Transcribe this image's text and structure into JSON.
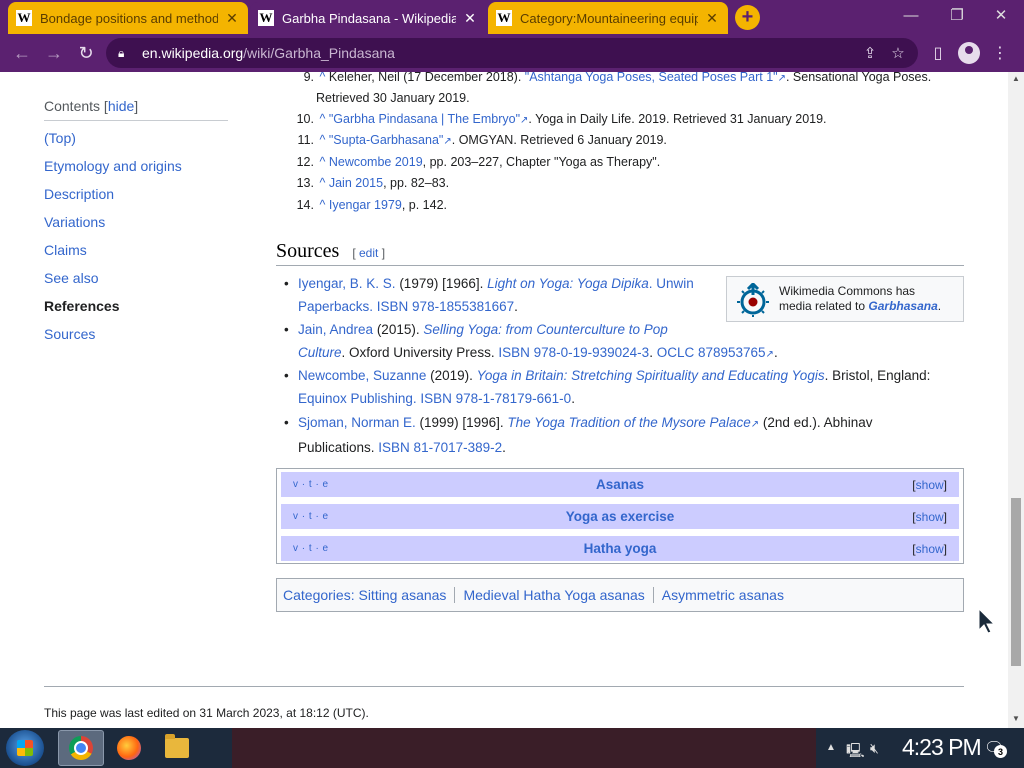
{
  "browser": {
    "tabs": [
      {
        "title": "Bondage positions and methods",
        "favicon": "W"
      },
      {
        "title": "Garbha Pindasana - Wikipedia",
        "favicon": "W"
      },
      {
        "title": "Category:Mountaineering equipment",
        "favicon": "W"
      }
    ],
    "url_domain": "en.wikipedia.org",
    "url_path": "/wiki/Garbha_Pindasana",
    "accent_color": "#5b2170",
    "tab_inactive_color": "#f4b400"
  },
  "toc": {
    "title": "Contents",
    "hide_label": "hide",
    "items": [
      "(Top)",
      "Etymology and origins",
      "Description",
      "Variations",
      "Claims",
      "See also",
      "References",
      "Sources"
    ],
    "active_index": 6
  },
  "references": [
    {
      "num": "9.",
      "caret": "^",
      "pre": "Keleher, Neil (17 December 2018). ",
      "link": "\"Ashtanga Yoga Poses, Seated Poses Part 1\"",
      "post": ". Sensational Yoga Poses.",
      "cont": "Retrieved 30 January 2019."
    },
    {
      "num": "10.",
      "caret": "^",
      "link": "\"Garbha Pindasana | The Embryo\"",
      "post": ". Yoga in Daily Life. 2019. Retrieved 31 January 2019."
    },
    {
      "num": "11.",
      "caret": "^",
      "link": "\"Supta-Garbhasana\"",
      "post": ". OMGYAN. Retrieved 6 January 2019."
    },
    {
      "num": "12.",
      "caret": "^",
      "link": "Newcombe 2019",
      "post": ", pp. 203–227, Chapter \"Yoga as Therapy\"."
    },
    {
      "num": "13.",
      "caret": "^",
      "link": "Jain 2015",
      "post": ", pp. 82–83."
    },
    {
      "num": "14.",
      "caret": "^",
      "link": "Iyengar 1979",
      "post": ", p. 142."
    }
  ],
  "sources_heading": {
    "title": "Sources",
    "edit": "edit"
  },
  "sources": [
    {
      "l1_author": "Iyengar, B. K. S.",
      "l1_text": " (1979) [1966]. ",
      "l1_title": "Light on Yoga: Yoga Dipika",
      "l1_tail": ". Unwin",
      "l2_link": "Paperbacks. ISBN 978-1855381667",
      "l2_tail": "."
    },
    {
      "l1_author": "Jain, Andrea",
      "l1_text": " (2015). ",
      "l1_title": "Selling Yoga: from Counterculture to Pop",
      "l2_title": "Culture",
      "l2_mid": ". Oxford University Press. ",
      "l2_link": "ISBN 978-0-19-939024-3",
      "l2_mid2": ". ",
      "l2_link2": "OCLC 878953765",
      "l2_tail": "."
    },
    {
      "l1_author": "Newcombe, Suzanne",
      "l1_text": " (2019). ",
      "l1_title": "Yoga in Britain: Stretching Spirituality and Educating Yogis",
      "l1_tail": ". Bristol, England:",
      "l2_link": "Equinox Publishing. ISBN 978-1-78179-661-0",
      "l2_tail": "."
    },
    {
      "l1_author": "Sjoman, Norman E.",
      "l1_text": " (1999) [1996]. ",
      "l1_title": "The Yoga Tradition of the Mysore Palace",
      "l1_tail": " (2nd ed.). Abhinav",
      "l2_text": "Publications. ",
      "l2_link": "ISBN 81-7017-389-2",
      "l2_tail": "."
    }
  ],
  "commons": {
    "line1": "Wikimedia Commons has",
    "line2_pre": "media related to ",
    "line2_link": "Garbhasana",
    "line2_post": "."
  },
  "navboxes": [
    {
      "vte": "v · t · e",
      "title": "Asanas",
      "show": "show"
    },
    {
      "vte": "v · t · e",
      "title": "Yoga as exercise",
      "show": "show"
    },
    {
      "vte": "v · t · e",
      "title": "Hatha yoga",
      "show": "show"
    }
  ],
  "categories": {
    "label": "Categories",
    "items": [
      "Sitting asanas",
      "Medieval Hatha Yoga asanas",
      "Asymmetric asanas"
    ]
  },
  "footer": {
    "text": "This page was last edited on 31 March 2023, at 18:12 (UTC)."
  },
  "taskbar": {
    "clock": "4:23 PM",
    "notifications": "3"
  }
}
